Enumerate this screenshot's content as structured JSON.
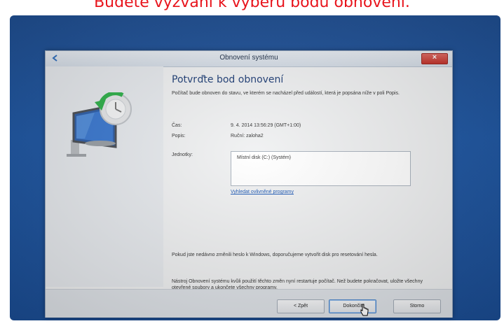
{
  "caption": "Budete vyzváni k výběru bodu obnovení.",
  "window": {
    "title": "Obnovení systému",
    "heading": "Potvrďte bod obnovení",
    "intro": "Počítač bude obnoven do stavu, ve kterém se nacházel před událostí, která je popsána níže v poli Popis.",
    "fields": {
      "time_label": "Čas:",
      "time_value": "9. 4. 2014 13:56:29 (GMT+1:00)",
      "desc_label": "Popis:",
      "desc_value": "Ruční: zaloha2",
      "drives_label": "Jednotky:",
      "drives_value": "Místní disk (C:) (Systém)"
    },
    "link": "Vyhledat ovlivněné programy",
    "note_password": "Pokud jste nedávno změnili heslo k Windows, doporučujeme vytvořit disk pro resetování hesla.",
    "note_restart": "Nástroj Obnovení systému kvůli použití těchto změn nyní restartuje počítač. Než budete pokračovat, uložte všechny otevřené soubory a ukončete všechny programy.",
    "buttons": {
      "back": "< Zpět",
      "finish": "Dokončit",
      "cancel": "Storno"
    }
  },
  "icons": {
    "back": "back-arrow-icon",
    "close": "close-icon",
    "hero": "system-restore-icon",
    "cursor": "mouse-cursor-icon"
  },
  "colors": {
    "caption": "#e8141c",
    "desktop": "#1e57a4",
    "close": "#c4322a",
    "heading": "#1f3f77",
    "link": "#1b57b5"
  }
}
